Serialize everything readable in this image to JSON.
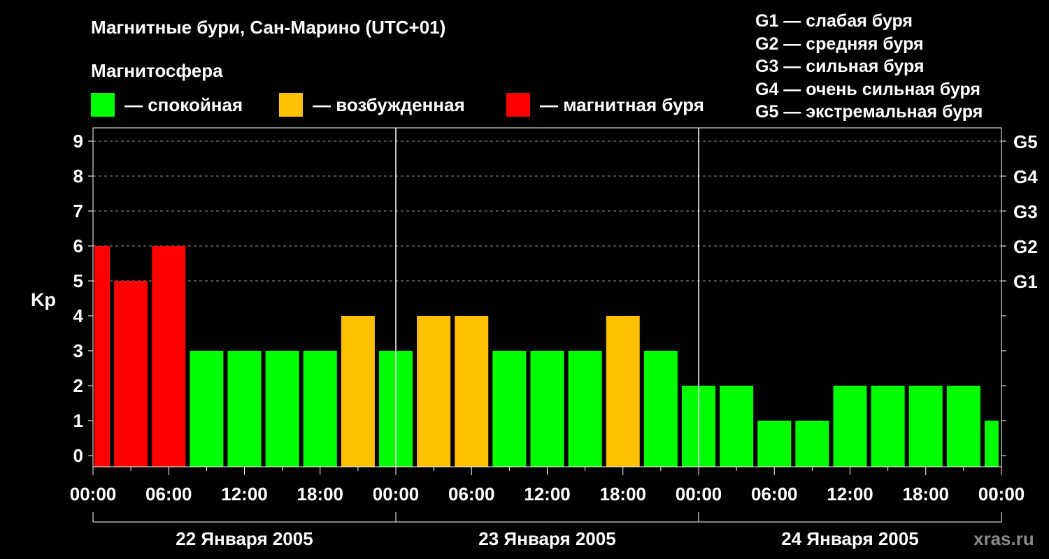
{
  "title": "Магнитные бури, Сан-Марино (UTC+01)",
  "magnetosphere": {
    "title": "Магнитосфера",
    "legend": [
      {
        "label": "— спокойная",
        "color": "#00ff00"
      },
      {
        "label": "— возбужденная",
        "color": "#ffc000"
      },
      {
        "label": "— магнитная буря",
        "color": "#ff0000"
      }
    ]
  },
  "g_scale": [
    "G1 — слабая буря",
    "G2 — средняя буря",
    "G3 — сильная буря",
    "G4 — очень сильная буря",
    "G5 — экстремальная буря"
  ],
  "watermark": "xras.ru",
  "chart_data": {
    "type": "bar",
    "ylabel": "Kp",
    "ylim": [
      0,
      9
    ],
    "y_ticks": [
      0,
      1,
      2,
      3,
      4,
      5,
      6,
      7,
      8,
      9
    ],
    "right_axis_labels": [
      {
        "kp": 5,
        "label": "G1"
      },
      {
        "kp": 6,
        "label": "G2"
      },
      {
        "kp": 7,
        "label": "G3"
      },
      {
        "kp": 8,
        "label": "G4"
      },
      {
        "kp": 9,
        "label": "G5"
      }
    ],
    "x_tick_labels": [
      "00:00",
      "06:00",
      "12:00",
      "18:00",
      "00:00",
      "06:00",
      "12:00",
      "18:00",
      "00:00",
      "06:00",
      "12:00",
      "18:00",
      "00:00"
    ],
    "days": [
      "22 Января 2005",
      "23 Января 2005",
      "24 Января 2005"
    ],
    "grid": "dashed horizontal at Kp 5–9",
    "interval_hours": 3,
    "values": [
      6,
      5,
      6,
      3,
      3,
      3,
      3,
      4,
      3,
      4,
      4,
      3,
      3,
      3,
      4,
      3,
      2,
      2,
      1,
      1,
      2,
      2,
      2,
      2,
      1
    ],
    "colors": {
      "quiet": "#00ff00",
      "active": "#ffc000",
      "storm": "#ff0000"
    }
  }
}
